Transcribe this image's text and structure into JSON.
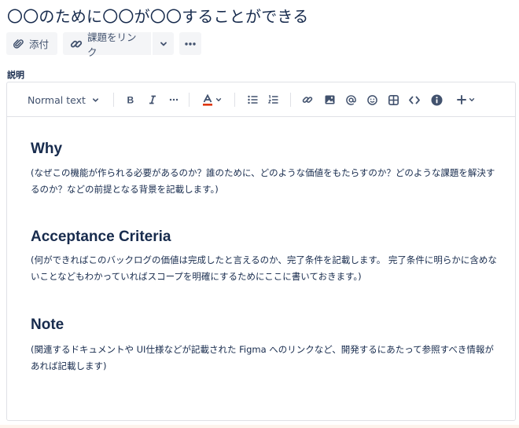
{
  "issue": {
    "title": "〇〇のために〇〇が〇〇することができる"
  },
  "actions": {
    "attach_label": "添付",
    "link_label": "課題をリンク",
    "icons": [
      "paperclip-icon",
      "link-icon",
      "chevron-down-icon",
      "more-icon"
    ]
  },
  "description": {
    "label": "説明",
    "toolbar": {
      "text_style": "Normal text",
      "icons": [
        "bold-icon",
        "italic-icon",
        "more-formatting-icon",
        "text-color-icon",
        "bullet-list-icon",
        "numbered-list-icon",
        "link-icon",
        "image-icon",
        "mention-icon",
        "emoji-icon",
        "table-icon",
        "code-icon",
        "info-icon",
        "insert-icon"
      ]
    },
    "sections": [
      {
        "heading": "Why",
        "body": "(なぜこの機能が作られる必要があるのか？誰のために、どのような価値をもたらすのか？どのような課題を解決するのか？などの前提となる背景を記載します。)"
      },
      {
        "heading": "Acceptance Criteria",
        "body": "(何ができればこのバックログの価値は完成したと言えるのか、完了条件を記載します。 完了条件に明らかに含めないことなどもわかっていればスコープを明確にするためにここに書いておきます。)"
      },
      {
        "heading": "Note",
        "body": "(関連するドキュメントや UI仕様などが記載された Figma へのリンクなど、開発するにあたって参照すべき情報があれば記載します)"
      }
    ]
  },
  "colors": {
    "text": "#172b4d",
    "subtle_text": "#42526e",
    "button_bg": "#f4f5f7",
    "border": "#dfe1e6"
  }
}
